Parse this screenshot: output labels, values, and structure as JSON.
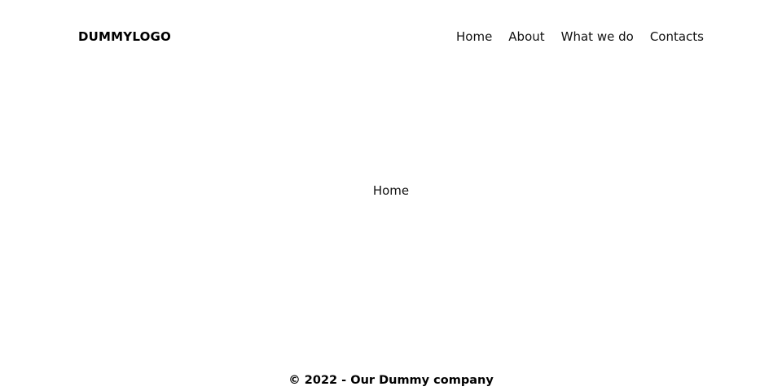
{
  "header": {
    "logo_text": "DUMMYLOGO",
    "nav": [
      {
        "label": "Home"
      },
      {
        "label": "About"
      },
      {
        "label": "What we do"
      },
      {
        "label": "Contacts"
      }
    ]
  },
  "main": {
    "content_text": "Home"
  },
  "footer": {
    "copyright_text": "© 2022 - Our Dummy company"
  }
}
